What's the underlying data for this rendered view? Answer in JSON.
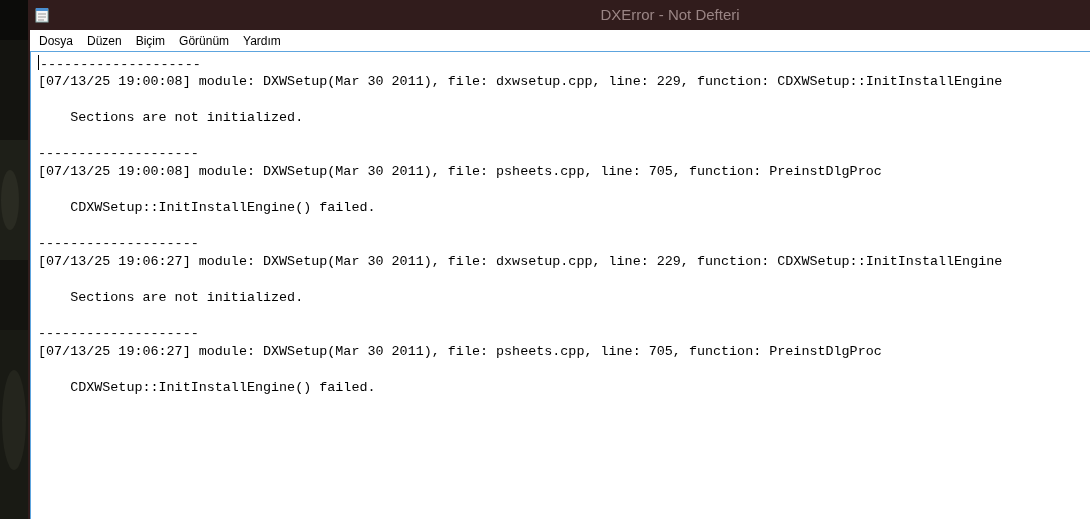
{
  "window": {
    "title": "DXError - Not Defteri"
  },
  "menu": [
    "Dosya",
    "Düzen",
    "Biçim",
    "Görünüm",
    "Yardım"
  ],
  "entries": [
    {
      "separator": "--------------------",
      "header": "[07/13/25 19:00:08] module: DXWSetup(Mar 30 2011), file: dxwsetup.cpp, line: 229, function: CDXWSetup::InitInstallEngine",
      "message": "Sections are not initialized."
    },
    {
      "separator": "--------------------",
      "header": "[07/13/25 19:00:08] module: DXWSetup(Mar 30 2011), file: psheets.cpp, line: 705, function: PreinstDlgProc",
      "message": "CDXWSetup::InitInstallEngine() failed."
    },
    {
      "separator": "--------------------",
      "header": "[07/13/25 19:06:27] module: DXWSetup(Mar 30 2011), file: dxwsetup.cpp, line: 229, function: CDXWSetup::InitInstallEngine",
      "message": "Sections are not initialized."
    },
    {
      "separator": "--------------------",
      "header": "[07/13/25 19:06:27] module: DXWSetup(Mar 30 2011), file: psheets.cpp, line: 705, function: PreinstDlgProc",
      "message": "CDXWSetup::InitInstallEngine() failed."
    }
  ]
}
